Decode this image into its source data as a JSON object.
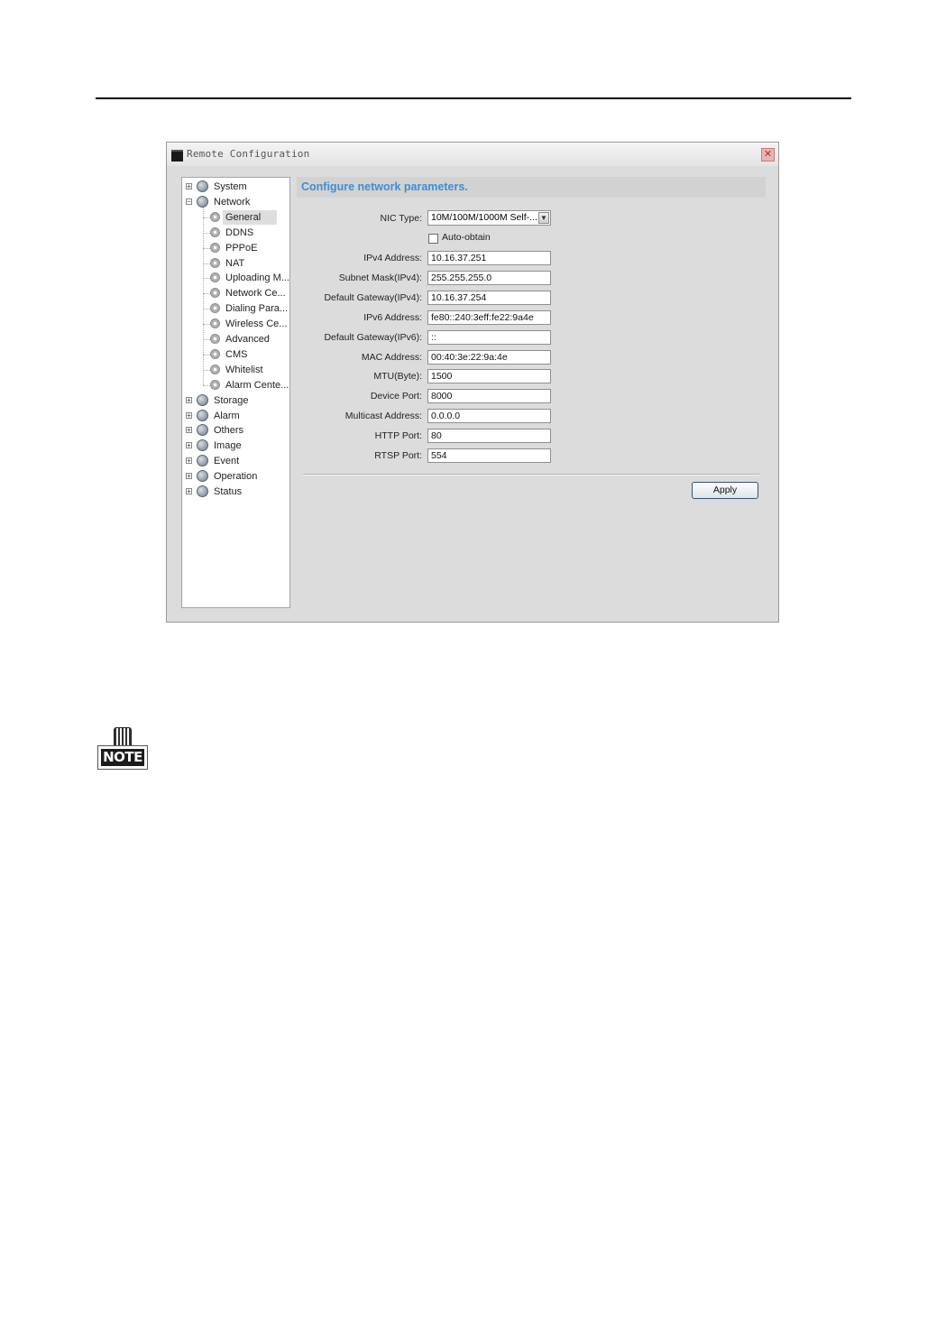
{
  "window": {
    "title": "Remote Configuration",
    "close_glyph": "✕"
  },
  "tree": [
    {
      "label": "System",
      "level": 0,
      "icon": "globe-icon",
      "expander": "+"
    },
    {
      "label": "Network",
      "level": 0,
      "icon": "globe-icon",
      "expander": "−"
    },
    {
      "label": "General",
      "level": 1,
      "icon": "gear-icon",
      "selected": true
    },
    {
      "label": "DDNS",
      "level": 1,
      "icon": "gear-icon"
    },
    {
      "label": "PPPoE",
      "level": 1,
      "icon": "gear-icon"
    },
    {
      "label": "NAT",
      "level": 1,
      "icon": "gear-icon"
    },
    {
      "label": "Uploading M...",
      "level": 1,
      "icon": "gear-icon"
    },
    {
      "label": "Network Ce...",
      "level": 1,
      "icon": "gear-icon"
    },
    {
      "label": "Dialing Para...",
      "level": 1,
      "icon": "gear-icon"
    },
    {
      "label": "Wireless Ce...",
      "level": 1,
      "icon": "gear-icon"
    },
    {
      "label": "Advanced",
      "level": 1,
      "icon": "gear-icon"
    },
    {
      "label": "CMS",
      "level": 1,
      "icon": "gear-icon"
    },
    {
      "label": "Whitelist",
      "level": 1,
      "icon": "gear-icon"
    },
    {
      "label": "Alarm Cente...",
      "level": 1,
      "icon": "gear-icon"
    },
    {
      "label": "Storage",
      "level": 0,
      "icon": "globe-icon",
      "expander": "+"
    },
    {
      "label": "Alarm",
      "level": 0,
      "icon": "globe-icon",
      "expander": "+"
    },
    {
      "label": "Others",
      "level": 0,
      "icon": "globe-icon",
      "expander": "+"
    },
    {
      "label": "Image",
      "level": 0,
      "icon": "globe-icon",
      "expander": "+"
    },
    {
      "label": "Event",
      "level": 0,
      "icon": "globe-icon",
      "expander": "+"
    },
    {
      "label": "Operation",
      "level": 0,
      "icon": "globe-icon",
      "expander": "+"
    },
    {
      "label": "Status",
      "level": 0,
      "icon": "globe-icon",
      "expander": "+"
    }
  ],
  "content": {
    "header": "Configure network parameters.",
    "nic_type_label": "NIC Type:",
    "nic_type_value": "10M/100M/1000M Self-...",
    "auto_obtain_label": "Auto-obtain",
    "fields": [
      {
        "label": "IPv4 Address:",
        "value": "10.16.37.251"
      },
      {
        "label": "Subnet Mask(IPv4):",
        "value": "255.255.255.0"
      },
      {
        "label": "Default Gateway(IPv4):",
        "value": "10.16.37.254"
      },
      {
        "label": "IPv6 Address:",
        "value": "fe80::240:3eff:fe22:9a4e"
      },
      {
        "label": "Default Gateway(IPv6):",
        "value": "::"
      },
      {
        "label": "MAC Address:",
        "value": "00:40:3e:22:9a:4e"
      },
      {
        "label": "MTU(Byte):",
        "value": "1500"
      },
      {
        "label": "Device Port:",
        "value": "8000"
      },
      {
        "label": "Multicast Address:",
        "value": "0.0.0.0"
      },
      {
        "label": "HTTP Port:",
        "value": "80"
      },
      {
        "label": "RTSP Port:",
        "value": "554"
      }
    ],
    "apply_label": "Apply"
  },
  "note": {
    "label": "NOTE"
  }
}
